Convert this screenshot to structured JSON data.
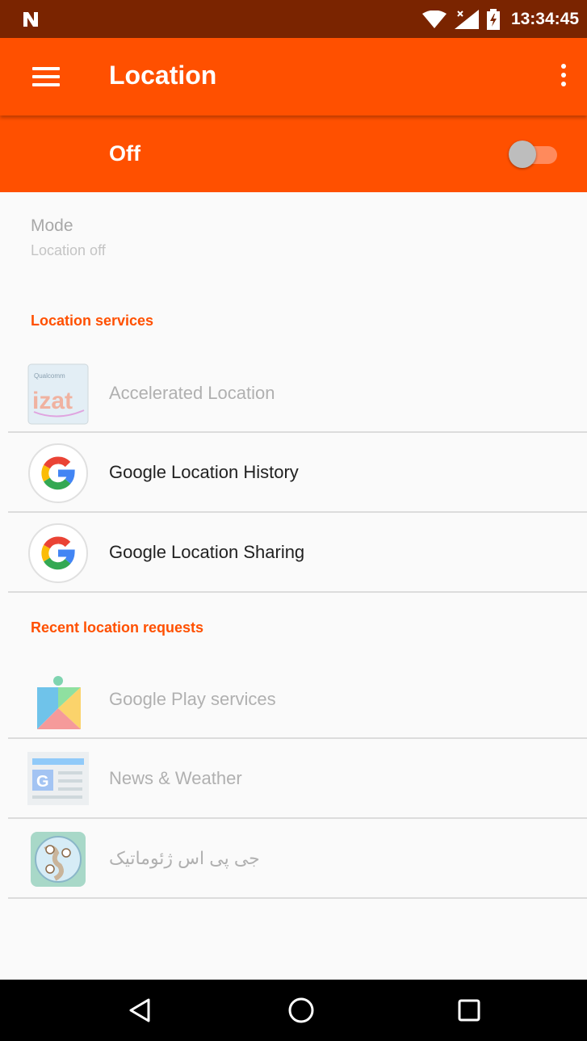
{
  "status_bar": {
    "time": "13:34:45"
  },
  "app_bar": {
    "title": "Location"
  },
  "master_switch": {
    "label": "Off",
    "state": "off"
  },
  "mode": {
    "title": "Mode",
    "subtitle": "Location off"
  },
  "location_services": {
    "header": "Location services",
    "items": [
      {
        "label": "Accelerated Location",
        "icon": "qualcomm-izat-icon",
        "enabled": false,
        "icon_text": "Qualcomm izat"
      },
      {
        "label": "Google Location History",
        "icon": "google-g-icon",
        "enabled": true
      },
      {
        "label": "Google Location Sharing",
        "icon": "google-g-icon",
        "enabled": true
      }
    ]
  },
  "recent_requests": {
    "header": "Recent location requests",
    "items": [
      {
        "label": "Google Play services",
        "icon": "google-play-services-icon",
        "enabled": false
      },
      {
        "label": "News & Weather",
        "icon": "news-weather-icon",
        "enabled": false
      },
      {
        "label": "جی پی اس ژئوماتیک",
        "icon": "globe-map-icon",
        "enabled": false
      }
    ]
  },
  "colors": {
    "accent": "#ff5000",
    "status_bar": "#7a2400",
    "nav_bar": "#000000"
  }
}
